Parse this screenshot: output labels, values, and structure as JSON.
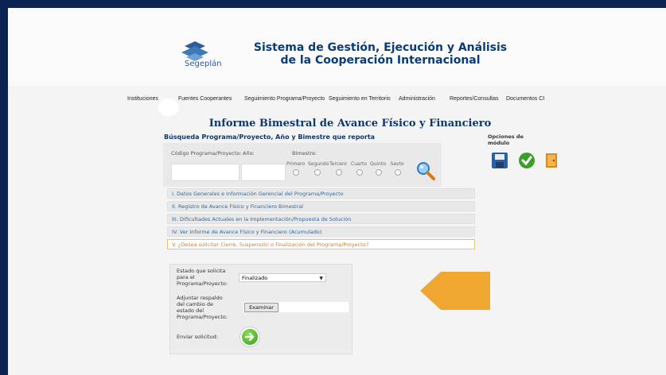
{
  "header": {
    "logo_text": "Segeplán",
    "title_line1": "Sistema de Gestión, Ejecución y Análisis",
    "title_line2": "de la Cooperación Internacional"
  },
  "nav": {
    "items": [
      "Instituciones",
      "Fuentes Cooperantes",
      "Seguimiento Programa/Proyecto",
      "Seguimiento en Territorio",
      "Administración",
      "Reportes/Consultas",
      "Documentos CI"
    ]
  },
  "page": {
    "title": "Informe Bimestral de Avance Físico y Financiero",
    "search_title": "Búsqueda Programa/Proyecto, Año y Bimestre que reporta"
  },
  "search": {
    "code_label": "Código Programa/Proyecto:",
    "year_label": "Año:",
    "bimestre_label": "Bimestre:",
    "code_value": "",
    "year_value": "",
    "bimestres": [
      "Primero",
      "Segundo",
      "Tercero",
      "Cuarto",
      "Quinto",
      "Sexto"
    ]
  },
  "options": {
    "title_line1": "Opciones de",
    "title_line2": "módulo",
    "icons": [
      "save-icon",
      "check-icon",
      "exit-door-icon"
    ]
  },
  "sections": [
    "I. Datos Generales e Información Gerencial del Programa/Proyecto",
    "II. Registro de Avance Físico y Financiero Bimestral",
    "III. Dificultades Actuales en la Implementación/Propuesta de Solución",
    "IV. Ver Informe de Avance Físico y Financiero (Acumulado)",
    "V. ¿Desea solicitar Cierre, Suspensión o Finalización del Programa/Proyecto?"
  ],
  "form": {
    "estado_label_1": "Estado que solicita",
    "estado_label_2": "para el",
    "estado_label_3": "Programa/Proyecto:",
    "estado_value": "Finalizado",
    "adjuntar_label_1": "Adjuntar respaldo",
    "adjuntar_label_2": "del cambio de",
    "adjuntar_label_3": "estado del",
    "adjuntar_label_4": "Programa/Proyecto:",
    "browse_label": "Examinar",
    "send_label": "Enviar solicitud:"
  },
  "colors": {
    "accent_orange": "#f0a732",
    "title_blue": "#11386b",
    "link_blue": "#2a6aa5"
  }
}
